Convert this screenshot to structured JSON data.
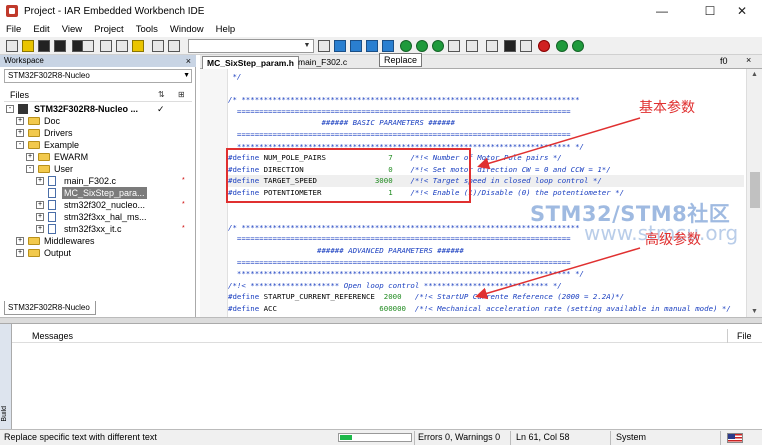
{
  "window": {
    "title": "Project - IAR Embedded Workbench IDE",
    "controls": {
      "minimize": "—",
      "maximize": "☐",
      "close": "✕"
    }
  },
  "menu": [
    "File",
    "Edit",
    "View",
    "Project",
    "Tools",
    "Window",
    "Help"
  ],
  "toolbar": {
    "tooltip": "Replace"
  },
  "workspace": {
    "header": "Workspace",
    "close": "×",
    "config": "STM32F302R8-Nucleo",
    "files_label": "Files",
    "bottom_tab": "STM32F302R8-Nucleo",
    "tree": [
      {
        "label": "STM32F302R8-Nucleo ...",
        "kind": "project",
        "box": "-",
        "check": "✓"
      },
      {
        "label": "Doc",
        "kind": "folder",
        "box": "+"
      },
      {
        "label": "Drivers",
        "kind": "folder",
        "box": "+"
      },
      {
        "label": "Example",
        "kind": "folder",
        "box": "-"
      },
      {
        "label": "EWARM",
        "kind": "folder",
        "box": "+"
      },
      {
        "label": "User",
        "kind": "folder",
        "box": "-"
      },
      {
        "label": "main_F302.c",
        "kind": "file",
        "box": "+",
        "mark": "*"
      },
      {
        "label": "MC_SixStep_para...",
        "kind": "file",
        "box": "",
        "selected": true
      },
      {
        "label": "stm32f302_nucleo...",
        "kind": "file",
        "box": "+",
        "mark": "*"
      },
      {
        "label": "stm32f3xx_hal_ms...",
        "kind": "file",
        "box": "+"
      },
      {
        "label": "stm32f3xx_it.c",
        "kind": "file",
        "box": "+",
        "mark": "*"
      },
      {
        "label": "Middlewares",
        "kind": "folder",
        "box": "+"
      },
      {
        "label": "Output",
        "kind": "folder",
        "box": "+"
      }
    ]
  },
  "editor": {
    "tabs": [
      "MC_SixStep_param.h",
      "main_F302.c"
    ],
    "function_box": "f0",
    "close": "×",
    "lines": [
      {
        "cm": " */"
      },
      {
        "cm": ""
      },
      {
        "cm": "/* ****************************************************************************"
      },
      {
        "cm": "  ==========================================================================="
      },
      {
        "cm": "                     ###### BASIC PARAMETERS ######"
      },
      {
        "cm": "  ==========================================================================="
      },
      {
        "cm": "  *************************************************************************** */"
      },
      {
        "kw": "#define",
        "id": " NUM_POLE_PAIRS              ",
        "num": "7",
        "cm": "    /*!< Number of Motor Pole pairs */"
      },
      {
        "kw": "#define",
        "id": " DIRECTION                   ",
        "num": "0",
        "cm": "    /*!< Set motor direction CW = 0 and CCW = 1*/"
      },
      {
        "kw": "#define",
        "id": " TARGET_SPEED             ",
        "num": "3000",
        "cm": "    /*!< Target speed in closed loop control */"
      },
      {
        "kw": "#define",
        "id": " POTENTIOMETER               ",
        "num": "1",
        "cm": "    /*!< Enable (1)/Disable (0) the potentiometer */"
      },
      {
        "cm": ""
      },
      {
        "cm": ""
      },
      {
        "cm": "/* ****************************************************************************"
      },
      {
        "cm": "  ==========================================================================="
      },
      {
        "cm": "                    ###### ADVANCED PARAMETERS ######"
      },
      {
        "cm": "  ==========================================================================="
      },
      {
        "cm": "  *************************************************************************** */"
      },
      {
        "cm": "/*!< ******************** Open loop control **************************** */"
      },
      {
        "kw": "#define",
        "id": " STARTUP_CURRENT_REFERENCE  ",
        "num": "2000",
        "cm": "   /*!< StartUP Currente Reference (2000 = 2.2A)*/"
      },
      {
        "kw": "#define",
        "id": " ACC                       ",
        "num": "600000",
        "cm": "  /*!< Mechanical acceleration rate (setting available in manual mode) */"
      }
    ]
  },
  "annotations": {
    "basic": "基本参数",
    "advanced": "高级参数"
  },
  "watermark": {
    "line1": "STM32/STM8社区",
    "line2": "www.stmcu.org"
  },
  "messages": {
    "side_label": "Build",
    "col_messages": "Messages",
    "col_file": "File"
  },
  "status": {
    "text": "Replace specific text with different text",
    "progress": 0.17,
    "errors": "Errors 0, Warnings 0",
    "position": "Ln 61, Col 58",
    "mode": "System"
  }
}
